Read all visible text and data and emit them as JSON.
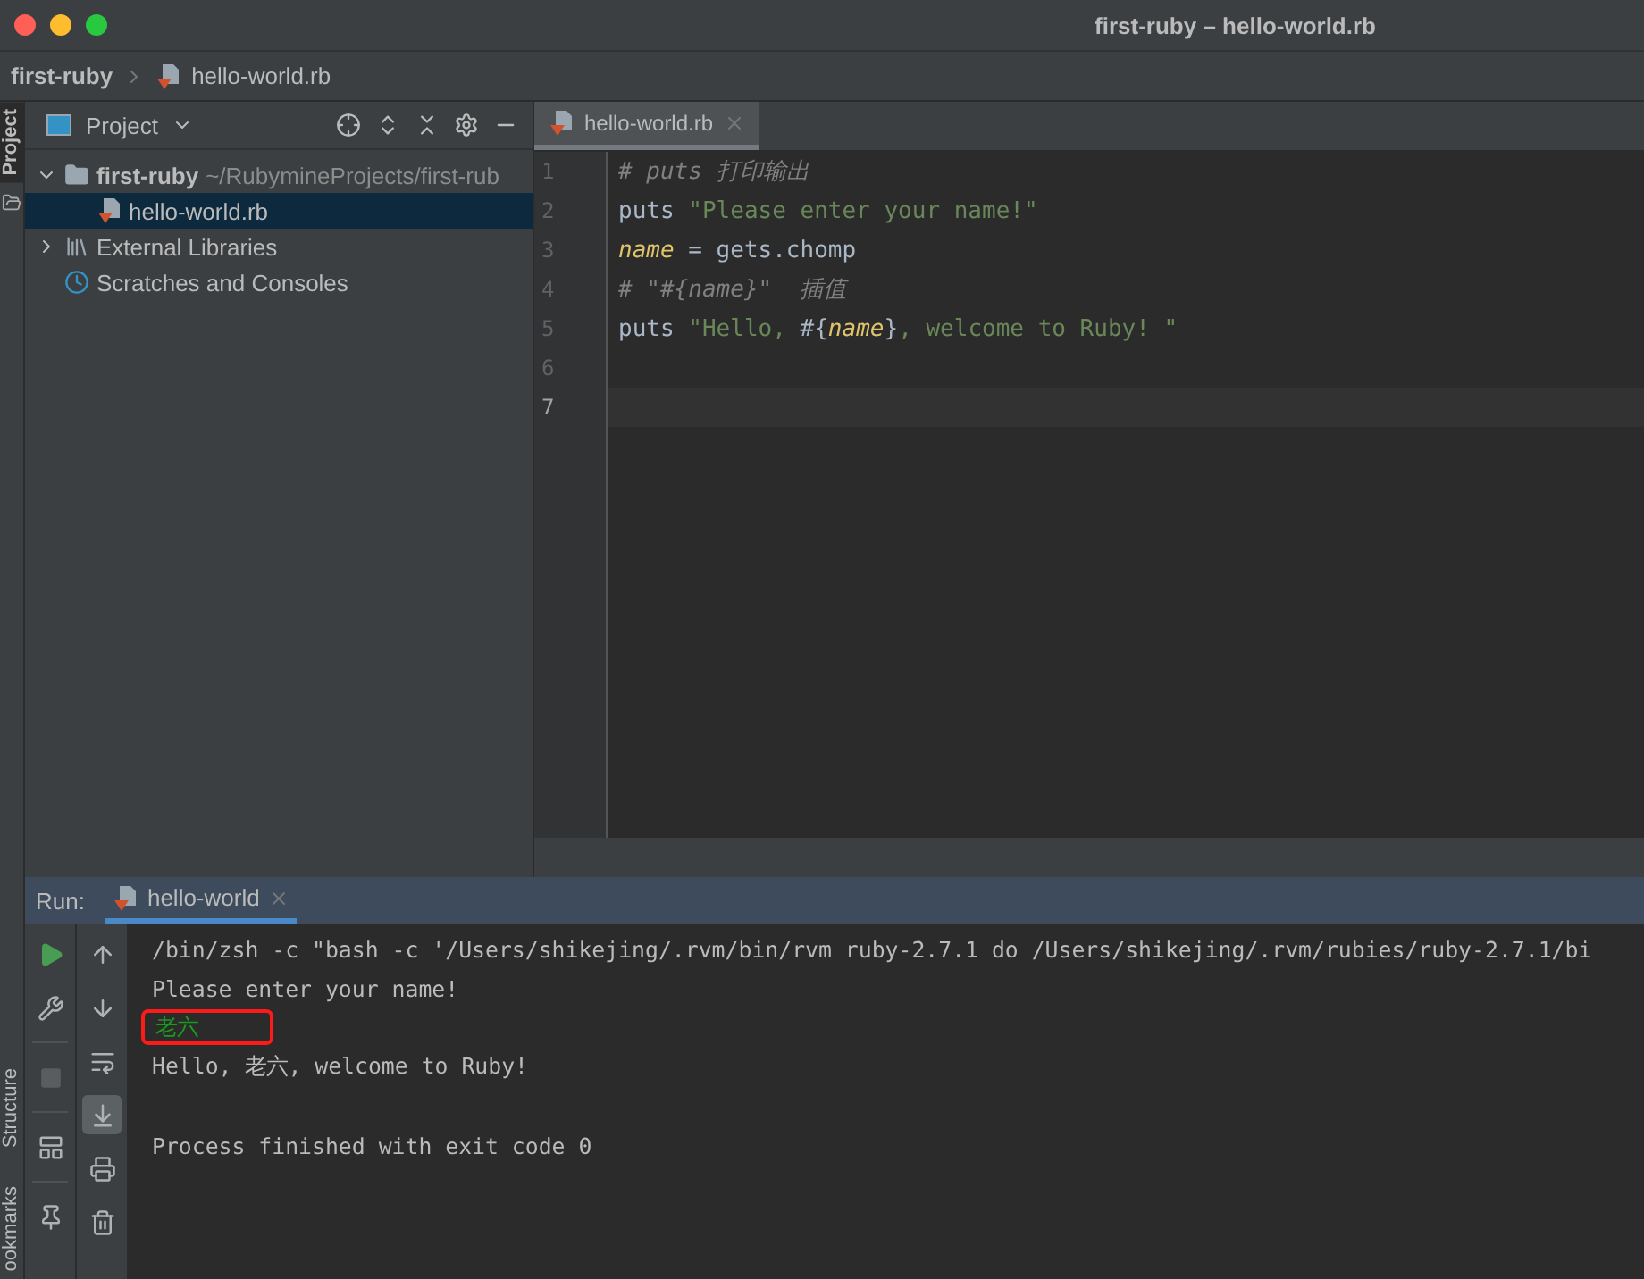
{
  "window": {
    "title": "first-ruby – hello-world.rb"
  },
  "breadcrumbs": [
    {
      "label": "first-ruby",
      "kind": "project"
    },
    {
      "label": "hello-world.rb",
      "kind": "ruby-file"
    }
  ],
  "side_tabs_left": [
    {
      "label": "Project",
      "selected": true
    }
  ],
  "project_panel": {
    "title": "Project",
    "tree": [
      {
        "label": "first-ruby",
        "path": "~/RubymineProjects/first-rub",
        "kind": "folder",
        "expanded": true,
        "selected": false,
        "children": [
          {
            "label": "hello-world.rb",
            "kind": "ruby-file",
            "selected": true
          }
        ]
      },
      {
        "label": "External Libraries",
        "kind": "library",
        "expanded": false,
        "selected": false
      },
      {
        "label": "Scratches and Consoles",
        "kind": "scratches",
        "selected": false
      }
    ]
  },
  "editor": {
    "tabs": [
      {
        "label": "hello-world.rb",
        "selected": true
      }
    ],
    "lines": [
      {
        "number": "1",
        "current": false,
        "tokens": [
          {
            "text": "# puts 打印输出",
            "kind": "comment"
          }
        ]
      },
      {
        "number": "2",
        "current": false,
        "tokens": [
          {
            "text": "puts ",
            "kind": "plain"
          },
          {
            "text": "\"Please enter your name!\"",
            "kind": "string"
          }
        ]
      },
      {
        "number": "3",
        "current": false,
        "tokens": [
          {
            "text": "name",
            "kind": "variable"
          },
          {
            "text": " = gets.chomp",
            "kind": "plain"
          }
        ]
      },
      {
        "number": "4",
        "current": false,
        "tokens": [
          {
            "text": "# \"#{name}\"  插值",
            "kind": "comment"
          }
        ]
      },
      {
        "number": "5",
        "current": false,
        "tokens": [
          {
            "text": "puts ",
            "kind": "plain"
          },
          {
            "text": "\"Hello, ",
            "kind": "string"
          },
          {
            "text": "#{",
            "kind": "plain"
          },
          {
            "text": "name",
            "kind": "variable"
          },
          {
            "text": "}",
            "kind": "plain"
          },
          {
            "text": ", welcome to Ruby! \"",
            "kind": "string"
          }
        ]
      },
      {
        "number": "6",
        "current": false
      },
      {
        "number": "7",
        "current": true
      }
    ]
  },
  "run_panel": {
    "label": "Run:",
    "tabs": [
      {
        "label": "hello-world",
        "selected": true
      }
    ],
    "console": [
      {
        "text": "/bin/zsh -c \"bash -c '/Users/shikejing/.rvm/bin/rvm ruby-2.7.1 do /Users/shikejing/.rvm/rubies/ruby-2.7.1/bi",
        "kind": "output",
        "highlighted": false
      },
      {
        "text": "Please enter your name!",
        "kind": "output",
        "highlighted": false
      },
      {
        "text": "老六",
        "kind": "input",
        "highlighted": true
      },
      {
        "text": "Hello, 老六, welcome to Ruby!",
        "kind": "output",
        "highlighted": false
      },
      {
        "kind": "blank"
      },
      {
        "text": "Process finished with exit code 0",
        "kind": "output",
        "highlighted": false
      }
    ]
  },
  "side_tabs_bottom_left": [
    {
      "label": "Structure",
      "selected": false
    },
    {
      "label": "ookmarks",
      "selected": false
    }
  ]
}
